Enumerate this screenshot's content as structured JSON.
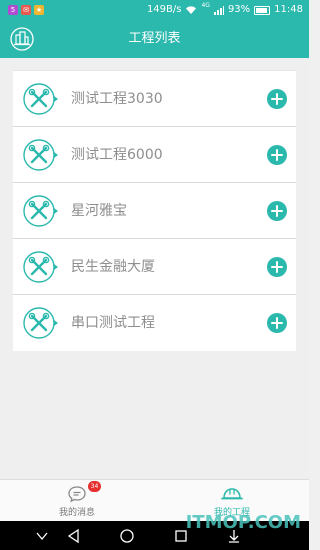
{
  "status_bar": {
    "speed": "149B/s",
    "network": "4G",
    "battery": "93%",
    "time": "11:48",
    "battery_level": 0.93
  },
  "header": {
    "title": "工程列表",
    "left_icon": "building-icon"
  },
  "projects": [
    {
      "name": "测试工程3030"
    },
    {
      "name": "测试工程6000"
    },
    {
      "name": "星河雅宝"
    },
    {
      "name": "民生金融大厦"
    },
    {
      "name": "串口测试工程"
    }
  ],
  "tabs": {
    "messages": {
      "label": "我的消息",
      "badge": "34",
      "icon": "chat-bubble-icon"
    },
    "projects": {
      "label": "我的工程",
      "icon": "hard-hat-icon"
    }
  },
  "watermark": {
    "text": "ITMOP.COM"
  },
  "colors": {
    "accent": "#2bb8ad",
    "badge": "#e5302f",
    "item_text": "#8e8e8e"
  }
}
